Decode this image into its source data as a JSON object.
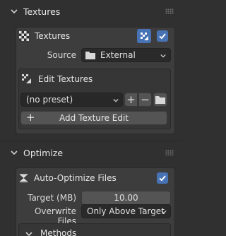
{
  "textures_panel": {
    "title": "Textures",
    "header_row": {
      "label": "Textures",
      "enabled": true
    },
    "source": {
      "label": "Source",
      "value": "External"
    },
    "edit_textures": {
      "title": "Edit Textures",
      "preset": "(no preset)",
      "add_plus": "+",
      "remove_minus": "−",
      "add_button_plus": "+",
      "add_button": "Add Texture Edit"
    }
  },
  "optimize_panel": {
    "title": "Optimize",
    "auto_optimize": {
      "label": "Auto-Optimize Files",
      "enabled": true
    },
    "target": {
      "label": "Target (MB)",
      "value": "10.00"
    },
    "overwrite": {
      "label": "Overwrite Files",
      "value": "Only Above Target"
    },
    "methods": {
      "title": "Methods"
    }
  },
  "colors": {
    "accent": "#4772b3",
    "background": "#303030",
    "box": "#3d3d3d"
  }
}
